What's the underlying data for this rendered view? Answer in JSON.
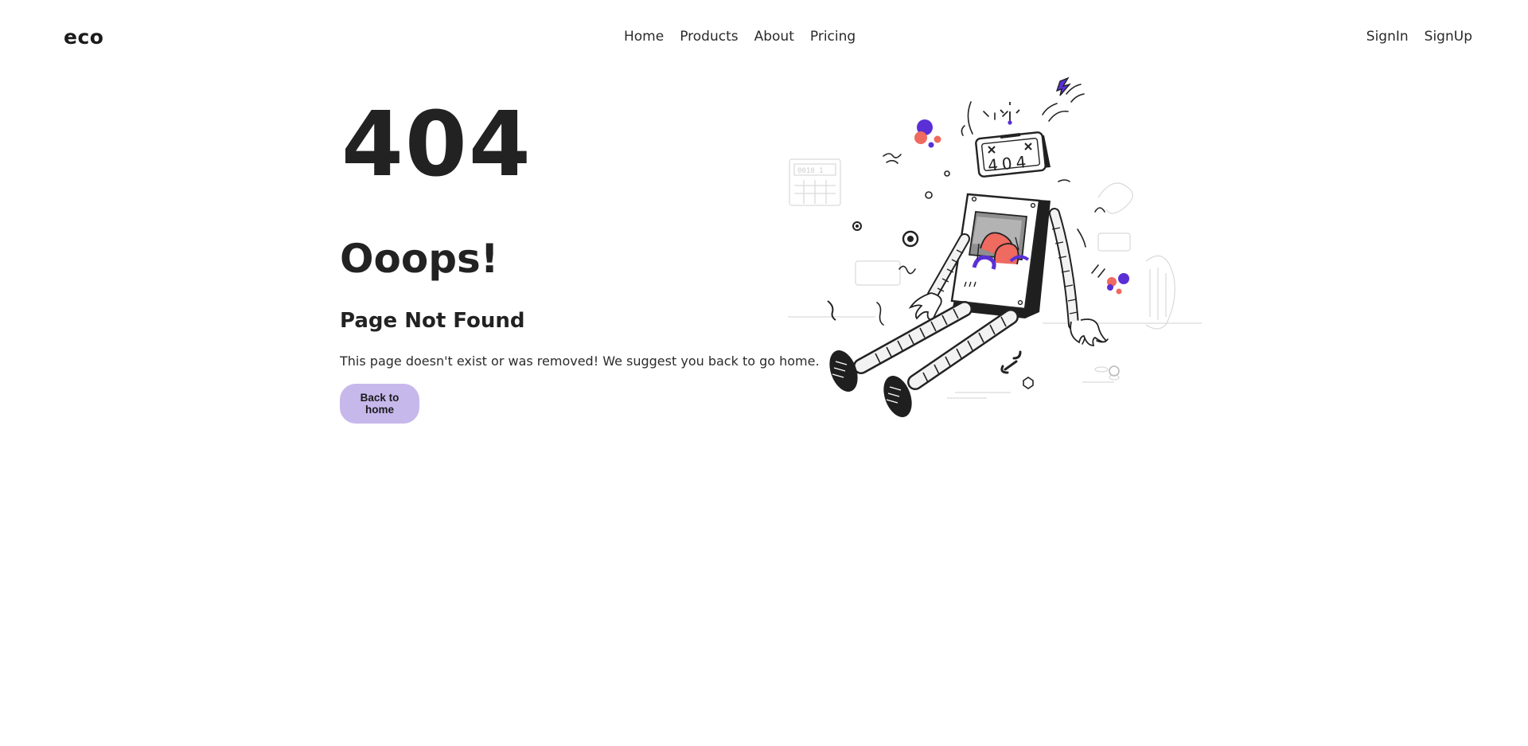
{
  "header": {
    "logo": "eco",
    "nav": [
      {
        "label": "Home"
      },
      {
        "label": "Products"
      },
      {
        "label": "About"
      },
      {
        "label": "Pricing"
      }
    ],
    "auth": [
      {
        "label": "SignIn"
      },
      {
        "label": "SignUp"
      }
    ]
  },
  "main": {
    "code": "404",
    "headline": "Ooops!",
    "subheadline": "Page Not Found",
    "description": "This page doesn't exist or was removed! We suggest you back to go home.",
    "button_label": "Back to home"
  },
  "illustration": {
    "screen_text": "404",
    "panel_text": "0010 1",
    "icon": "broken-robot-illustration"
  },
  "colors": {
    "accent": "#c7b8ec",
    "purple": "#5a2fd6",
    "coral": "#ef6a5f",
    "text": "#222222"
  }
}
